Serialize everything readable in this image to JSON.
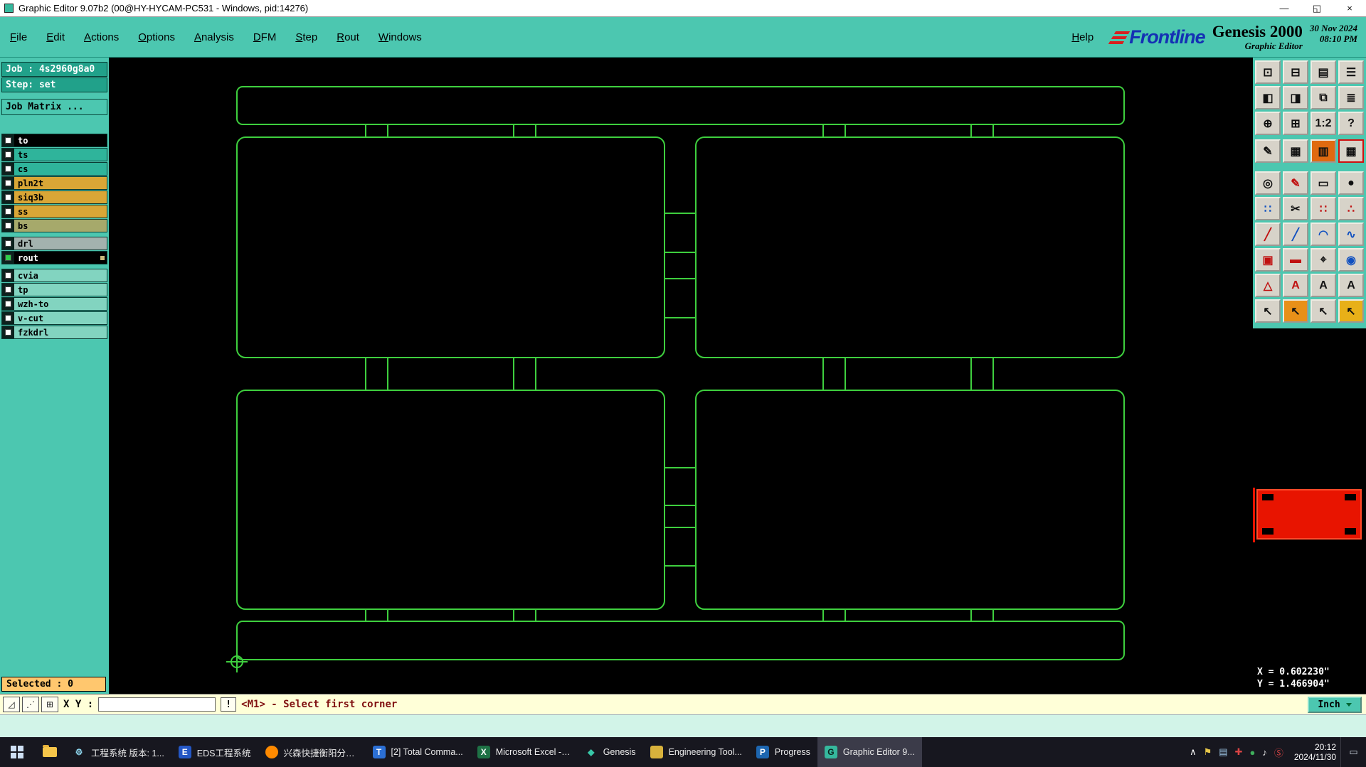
{
  "colors": {
    "teal": "#4cc7b0",
    "teal_dark": "#21a18a",
    "canvas_bg": "#000000",
    "pcb_outline": "#3ecf3e",
    "navigator_red": "#e81400",
    "command_bg": "#ffffd8",
    "subbar_bg": "#d2f4e8",
    "taskbar_bg": "#17171f",
    "selected_bg": "#ffc76e",
    "message_color": "#801010"
  },
  "titlebar": {
    "title": "Graphic Editor 9.07b2 (00@HY-HYCAM-PC531 - Windows, pid:14276)",
    "controls": [
      {
        "name": "minimize-icon",
        "glyph": "—"
      },
      {
        "name": "restore-icon",
        "glyph": "◱"
      },
      {
        "name": "close-icon",
        "glyph": "×"
      }
    ]
  },
  "menu": {
    "items": [
      "File",
      "Edit",
      "Actions",
      "Options",
      "Analysis",
      "DFM",
      "Step",
      "Rout",
      "Windows"
    ],
    "help": "Help"
  },
  "brand": {
    "logo_text": "Frontline",
    "product": "Genesis 2000",
    "subtitle": "Graphic Editor",
    "date": "30 Nov 2024",
    "time": "08:10 PM"
  },
  "sidebar": {
    "job": "Job : 4s2960g8a0",
    "step": "Step: set",
    "job_matrix": "Job Matrix ...",
    "selected": "Selected : 0",
    "layers": [
      {
        "name": "to",
        "bg": "#000000",
        "fg": "#ffffff"
      },
      {
        "name": "ts",
        "bg": "#2fb49b",
        "fg": "#000000"
      },
      {
        "name": "cs",
        "bg": "#2fb49b",
        "fg": "#000000"
      },
      {
        "name": "pln2t",
        "bg": "#d9a636",
        "fg": "#000000"
      },
      {
        "name": "siq3b",
        "bg": "#d9a636",
        "fg": "#000000"
      },
      {
        "name": "ss",
        "bg": "#d9a636",
        "fg": "#000000"
      },
      {
        "name": "bs",
        "bg": "#a6a96b",
        "fg": "#000000",
        "gap_after": true
      },
      {
        "name": "drl",
        "bg": "#a3b2ae",
        "fg": "#000000"
      },
      {
        "name": "rout",
        "bg": "#000000",
        "fg": "#ffffff",
        "check": "#2fd04a",
        "marker": true,
        "gap_after": true
      },
      {
        "name": "cvia",
        "bg": "#82d4c0",
        "fg": "#000000"
      },
      {
        "name": "tp",
        "bg": "#82d4c0",
        "fg": "#000000"
      },
      {
        "name": "wzh-to",
        "bg": "#82d4c0",
        "fg": "#000000"
      },
      {
        "name": "v-cut",
        "bg": "#82d4c0",
        "fg": "#000000"
      },
      {
        "name": "fzkdrl",
        "bg": "#82d4c0",
        "fg": "#000000"
      }
    ]
  },
  "toolbar": {
    "buttons": [
      {
        "name": "fit-screen-icon",
        "glyph": "⊡"
      },
      {
        "name": "dual-screen-icon",
        "glyph": "⊟"
      },
      {
        "name": "clipboard-icon",
        "glyph": "▤"
      },
      {
        "name": "layer-list-icon",
        "glyph": "☰"
      },
      {
        "name": "pan-left-icon",
        "glyph": "◧"
      },
      {
        "name": "pan-right-icon",
        "glyph": "◨"
      },
      {
        "name": "overlay-icon",
        "glyph": "⧉"
      },
      {
        "name": "rows-icon",
        "glyph": "≣"
      },
      {
        "name": "zoom-fit-icon",
        "glyph": "⊕"
      },
      {
        "name": "zoom-center-icon",
        "glyph": "⊞"
      },
      {
        "name": "zoom-ratio-icon",
        "glyph": "1:2"
      },
      {
        "name": "help-icon",
        "glyph": "?"
      },
      {
        "name": "notes-icon",
        "glyph": "✎"
      },
      {
        "name": "grid-icon",
        "glyph": "▦"
      },
      {
        "name": "film-icon",
        "glyph": "▥",
        "bg": "#e06a10"
      },
      {
        "name": "film-active-icon",
        "glyph": "▦",
        "border": "#d01010"
      },
      {
        "name": "circle-tool-icon",
        "glyph": "◎"
      },
      {
        "name": "sketch-icon",
        "glyph": "✎",
        "fg": "#c01010"
      },
      {
        "name": "measure-icon",
        "glyph": "▭"
      },
      {
        "name": "dot-tool-icon",
        "glyph": "●"
      },
      {
        "name": "points-icon",
        "glyph": "∷",
        "fg": "#1050c0"
      },
      {
        "name": "cut-icon",
        "glyph": "✂"
      },
      {
        "name": "red-points-icon",
        "glyph": "∷",
        "fg": "#c01010"
      },
      {
        "name": "mixed-points-icon",
        "glyph": "∴",
        "fg": "#c01010"
      },
      {
        "name": "red-line-icon",
        "glyph": "╱",
        "fg": "#c01010"
      },
      {
        "name": "blue-line-icon",
        "glyph": "╱",
        "fg": "#1050c0"
      },
      {
        "name": "arc-icon",
        "glyph": "◠",
        "fg": "#1050c0"
      },
      {
        "name": "polyline-icon",
        "glyph": "∿",
        "fg": "#1050c0"
      },
      {
        "name": "pad-icon",
        "glyph": "▣",
        "fg": "#c01010"
      },
      {
        "name": "trace-icon",
        "glyph": "▬",
        "fg": "#c01010"
      },
      {
        "name": "target-icon",
        "glyph": "⌖"
      },
      {
        "name": "via-icon",
        "glyph": "◉",
        "fg": "#1050c0"
      },
      {
        "name": "triangle-icon",
        "glyph": "△",
        "fg": "#c01010"
      },
      {
        "name": "text-red-icon",
        "glyph": "A",
        "fg": "#c01010"
      },
      {
        "name": "text-icon",
        "glyph": "A"
      },
      {
        "name": "text-box-icon",
        "glyph": "A"
      },
      {
        "name": "select-arrow-icon",
        "glyph": "↖"
      },
      {
        "name": "select-arrow-active-icon",
        "glyph": "↖",
        "bg": "#e89018"
      },
      {
        "name": "select-plus-icon",
        "glyph": "↖"
      },
      {
        "name": "select-special-icon",
        "glyph": "↖",
        "bg": "#e8b018"
      }
    ]
  },
  "navigator": {
    "x_readout": "X = 0.602230\"",
    "y_readout": "Y = 1.466904\""
  },
  "commandbar": {
    "xy_label": "X Y :",
    "input_value": "",
    "warn_glyph": "!",
    "message": "<M1> - Select first corner",
    "units": "Inch",
    "tools": [
      {
        "name": "corner-tool-icon",
        "glyph": "◿"
      },
      {
        "name": "snap-tool-icon",
        "glyph": "⋰"
      },
      {
        "name": "grid-tool-icon",
        "glyph": "⊞"
      }
    ]
  },
  "taskbar": {
    "apps": [
      {
        "label": "工程系统  版本: 1...",
        "icon_text": "⚙",
        "icon_bg": "transparent",
        "icon_fg": "#8fd8f0"
      },
      {
        "label": "EDS工程系统",
        "icon_text": "E",
        "icon_bg": "#2457c5",
        "icon_fg": "#ffffff"
      },
      {
        "label": "兴森快捷衡阳分公...",
        "icon_text": "",
        "icon_bg": "#ff8a00",
        "icon_fg": "#ffffff",
        "round": true
      },
      {
        "label": "[2] Total Comma...",
        "icon_text": "T",
        "icon_bg": "#2b6fd4",
        "icon_fg": "#ffffff"
      },
      {
        "label": "Microsoft Excel - ...",
        "icon_text": "X",
        "icon_bg": "#1e7145",
        "icon_fg": "#ffffff"
      },
      {
        "label": "Genesis",
        "icon_text": "◆",
        "icon_bg": "transparent",
        "icon_fg": "#38c8a8"
      },
      {
        "label": "Engineering Tool...",
        "icon_text": "",
        "icon_bg": "#d8b23c",
        "icon_fg": "#222222"
      },
      {
        "label": "Progress",
        "icon_text": "P",
        "icon_bg": "#1d66b0",
        "icon_fg": "#ffffff"
      },
      {
        "label": "Graphic Editor 9...",
        "icon_text": "G",
        "icon_bg": "#35b89d",
        "icon_fg": "#08221c",
        "active": true
      }
    ],
    "tray": [
      {
        "name": "tray-expand-icon",
        "glyph": "∧",
        "color": "#ffffff"
      },
      {
        "name": "flag-icon",
        "glyph": "⚑",
        "color": "#e8c84a"
      },
      {
        "name": "network-icon",
        "glyph": "▤",
        "color": "#9fc8e8"
      },
      {
        "name": "health-icon",
        "glyph": "✚",
        "color": "#d84444"
      },
      {
        "name": "status-icon",
        "glyph": "●",
        "color": "#3fae5c"
      },
      {
        "name": "sound-icon",
        "glyph": "♪",
        "color": "#e8e8e8"
      },
      {
        "name": "security-icon",
        "glyph": "Ⓢ",
        "color": "#d84444"
      }
    ],
    "time": "20:12",
    "date": "2024/11/30",
    "note_glyph": "▭"
  }
}
